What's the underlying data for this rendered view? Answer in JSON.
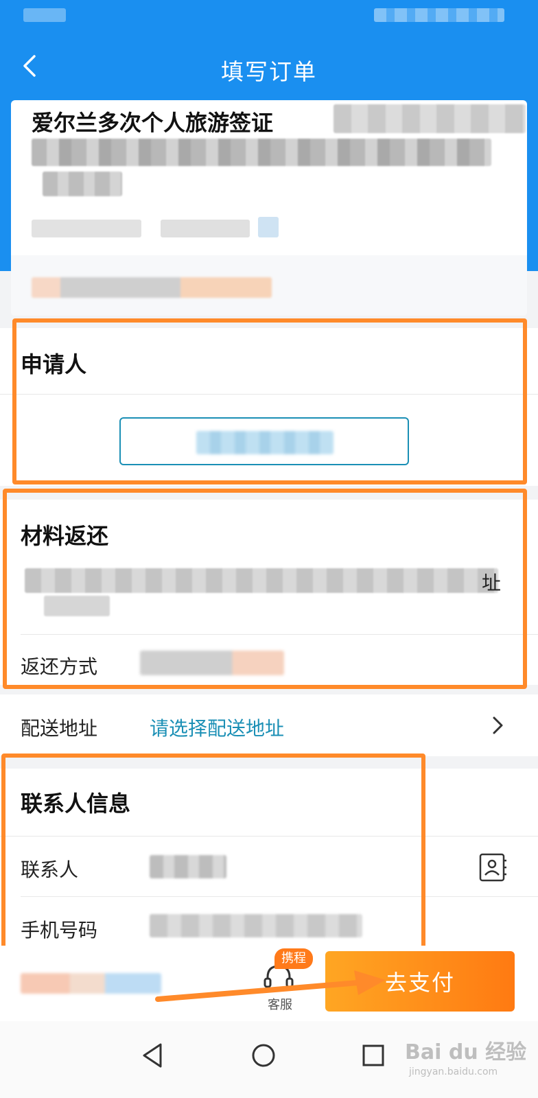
{
  "header": {
    "title": "填写订单"
  },
  "product": {
    "title": "爱尔兰多次个人旅游签证"
  },
  "applicant": {
    "title": "申请人"
  },
  "material": {
    "title": "材料返还",
    "address_tail": "址",
    "return_method_label": "返还方式"
  },
  "delivery": {
    "label": "配送地址",
    "placeholder": "请选择配送地址"
  },
  "contact": {
    "title": "联系人信息",
    "name_label": "联系人",
    "phone_label": "手机号码"
  },
  "bottom_bar": {
    "service_badge": "携程",
    "service_label": "客服",
    "pay_label": "去支付"
  },
  "watermark": {
    "main": "Bai du 经验",
    "sub": "jingyan.baidu.com"
  },
  "colors": {
    "header_blue": "#1a8ff0",
    "link_blue": "#1a8fb5",
    "highlight_orange": "#ff8a2a",
    "pay_orange": "#ff7a12"
  }
}
